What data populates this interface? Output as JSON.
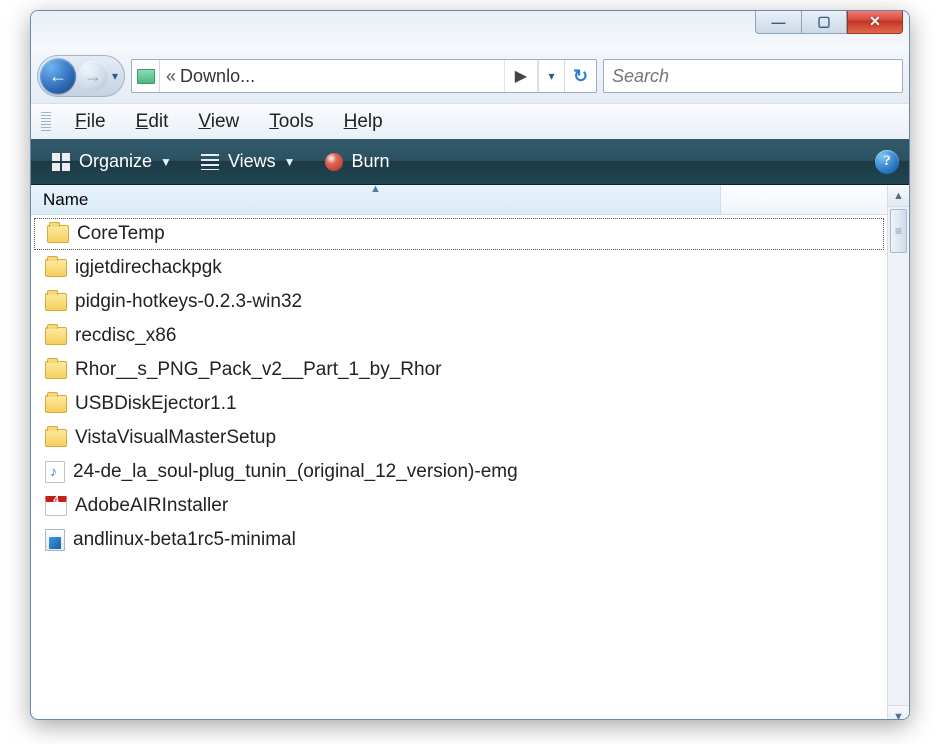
{
  "caption": {
    "min_glyph": "—",
    "max_glyph": "▢",
    "close_glyph": "✕"
  },
  "nav": {
    "back_glyph": "←",
    "forward_glyph": "→",
    "recent_caret": "▾"
  },
  "breadcrumb": {
    "chevrons": "«",
    "segment": "Downlo...",
    "seg_caret": "▶",
    "dropdown_caret": "▾",
    "refresh_glyph": "↻"
  },
  "search": {
    "placeholder": "Search"
  },
  "menubar": {
    "file": "File",
    "file_key": "F",
    "edit": "Edit",
    "edit_key": "E",
    "view": "View",
    "view_key": "V",
    "tools": "Tools",
    "tools_key": "T",
    "help": "Help",
    "help_key": "H"
  },
  "cmdbar": {
    "organize": "Organize",
    "views": "Views",
    "burn": "Burn",
    "help_glyph": "?"
  },
  "columns": {
    "name": "Name",
    "sort_glyph": "▲"
  },
  "files": [
    {
      "name": "CoreTemp",
      "icon": "folder",
      "focused": true
    },
    {
      "name": "igjetdirechackpgk",
      "icon": "folder"
    },
    {
      "name": "pidgin-hotkeys-0.2.3-win32",
      "icon": "folder"
    },
    {
      "name": "recdisc_x86",
      "icon": "folder"
    },
    {
      "name": "Rhor__s_PNG_Pack_v2__Part_1_by_Rhor",
      "icon": "folder"
    },
    {
      "name": "USBDiskEjector1.1",
      "icon": "folder"
    },
    {
      "name": "VistaVisualMasterSetup",
      "icon": "folder"
    },
    {
      "name": "24-de_la_soul-plug_tunin_(original_12_version)-emg",
      "icon": "audio"
    },
    {
      "name": "AdobeAIRInstaller",
      "icon": "adobe"
    },
    {
      "name": "andlinux-beta1rc5-minimal",
      "icon": "installer"
    }
  ],
  "scrollbar": {
    "up_glyph": "▲",
    "down_glyph": "▼"
  }
}
